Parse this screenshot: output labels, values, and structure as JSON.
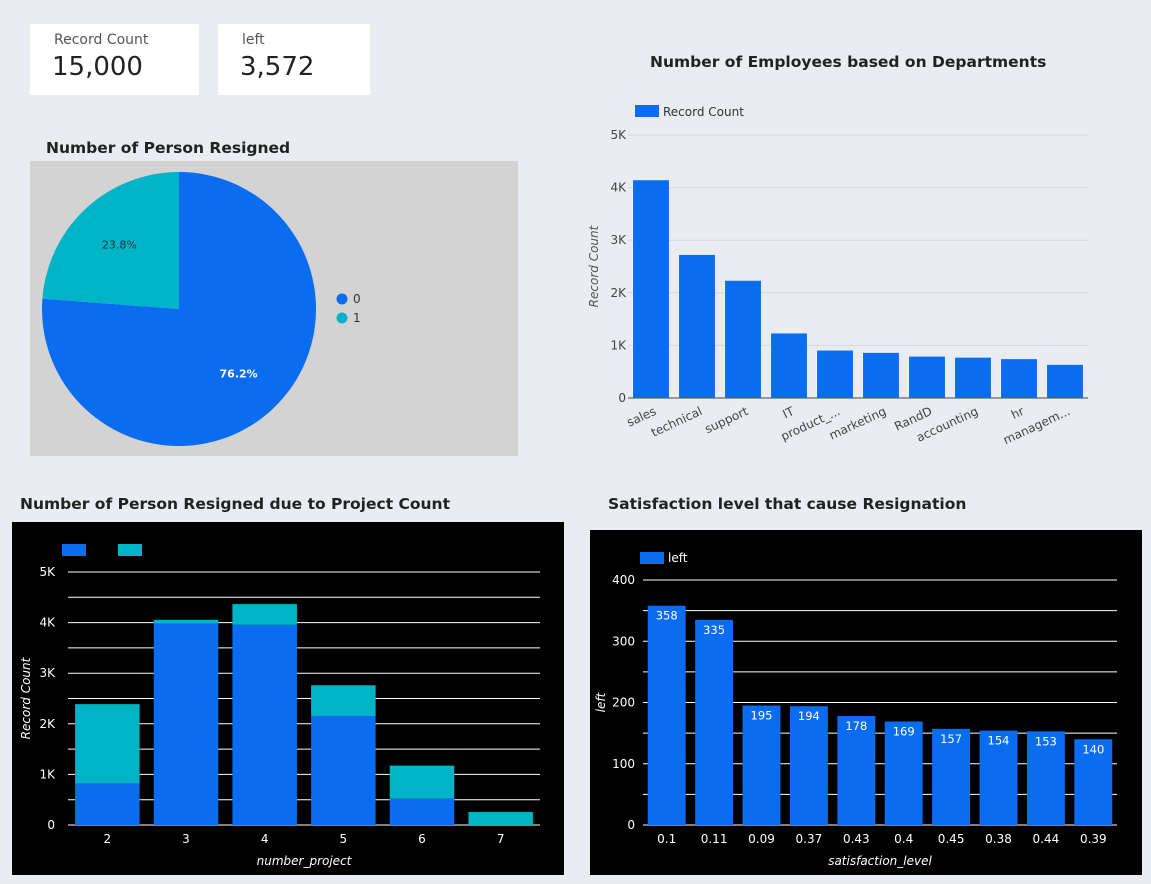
{
  "kpis": [
    {
      "label": "Record Count",
      "value": "15,000"
    },
    {
      "label": "left",
      "value": "3,572"
    }
  ],
  "titles": {
    "pie": "Number of Person Resigned",
    "dept": "Number of Employees based on Departments",
    "project": "Number of Person Resigned due to Project Count",
    "satisfaction": "Satisfaction level that cause Resignation"
  },
  "colors": {
    "primary": "#0a6cf0",
    "secondary": "#00b4c8",
    "pie_bg": "#d3d3d3",
    "dark_bg": "#000000"
  },
  "chart_data": [
    {
      "id": "pie",
      "type": "pie",
      "title": "Number of Person Resigned",
      "slices": [
        {
          "label": "0",
          "value": 76.2,
          "display": "76.2%",
          "color": "#0a6cf0"
        },
        {
          "label": "1",
          "value": 23.8,
          "display": "23.8%",
          "color": "#00b4c8"
        }
      ],
      "legend": "right"
    },
    {
      "id": "dept",
      "type": "bar",
      "title": "Number of Employees based on Departments",
      "xlabel": "",
      "ylabel": "Record Count",
      "ylim": [
        0,
        5000
      ],
      "yticks": [
        "0",
        "1K",
        "2K",
        "3K",
        "4K",
        "5K"
      ],
      "categories": [
        "sales",
        "technical",
        "support",
        "IT",
        "product_...",
        "marketing",
        "RandD",
        "accounting",
        "hr",
        "managem..."
      ],
      "series": [
        {
          "name": "Record Count",
          "values": [
            4140,
            2720,
            2229,
            1227,
            902,
            858,
            787,
            767,
            739,
            630
          ]
        }
      ],
      "legend": "top-left",
      "grid": true
    },
    {
      "id": "project",
      "type": "bar",
      "stacked": true,
      "title": "Number of Person Resigned due to Project Count",
      "xlabel": "number_project",
      "ylabel": "Record Count",
      "ylim": [
        0,
        5000
      ],
      "yticks": [
        "0",
        "1K",
        "2K",
        "3K",
        "4K",
        "5K"
      ],
      "categories": [
        "2",
        "3",
        "4",
        "5",
        "6",
        "7"
      ],
      "series": [
        {
          "values": [
            821,
            3983,
            3956,
            2149,
            519,
            0
          ]
        },
        {
          "values": [
            1567,
            72,
            409,
            612,
            655,
            256
          ]
        }
      ],
      "legend": "top-left",
      "grid": true
    },
    {
      "id": "satisfaction",
      "type": "bar",
      "title": "Satisfaction level that cause Resignation",
      "xlabel": "satisfaction_level",
      "ylabel": "left",
      "ylim": [
        0,
        400
      ],
      "yticks": [
        "0",
        "100",
        "200",
        "300",
        "400"
      ],
      "categories": [
        "0.1",
        "0.11",
        "0.09",
        "0.37",
        "0.43",
        "0.4",
        "0.45",
        "0.38",
        "0.44",
        "0.39"
      ],
      "series": [
        {
          "name": "left",
          "values": [
            358,
            335,
            195,
            194,
            178,
            169,
            157,
            154,
            153,
            140
          ]
        }
      ],
      "legend": "top-left",
      "grid": true
    }
  ]
}
